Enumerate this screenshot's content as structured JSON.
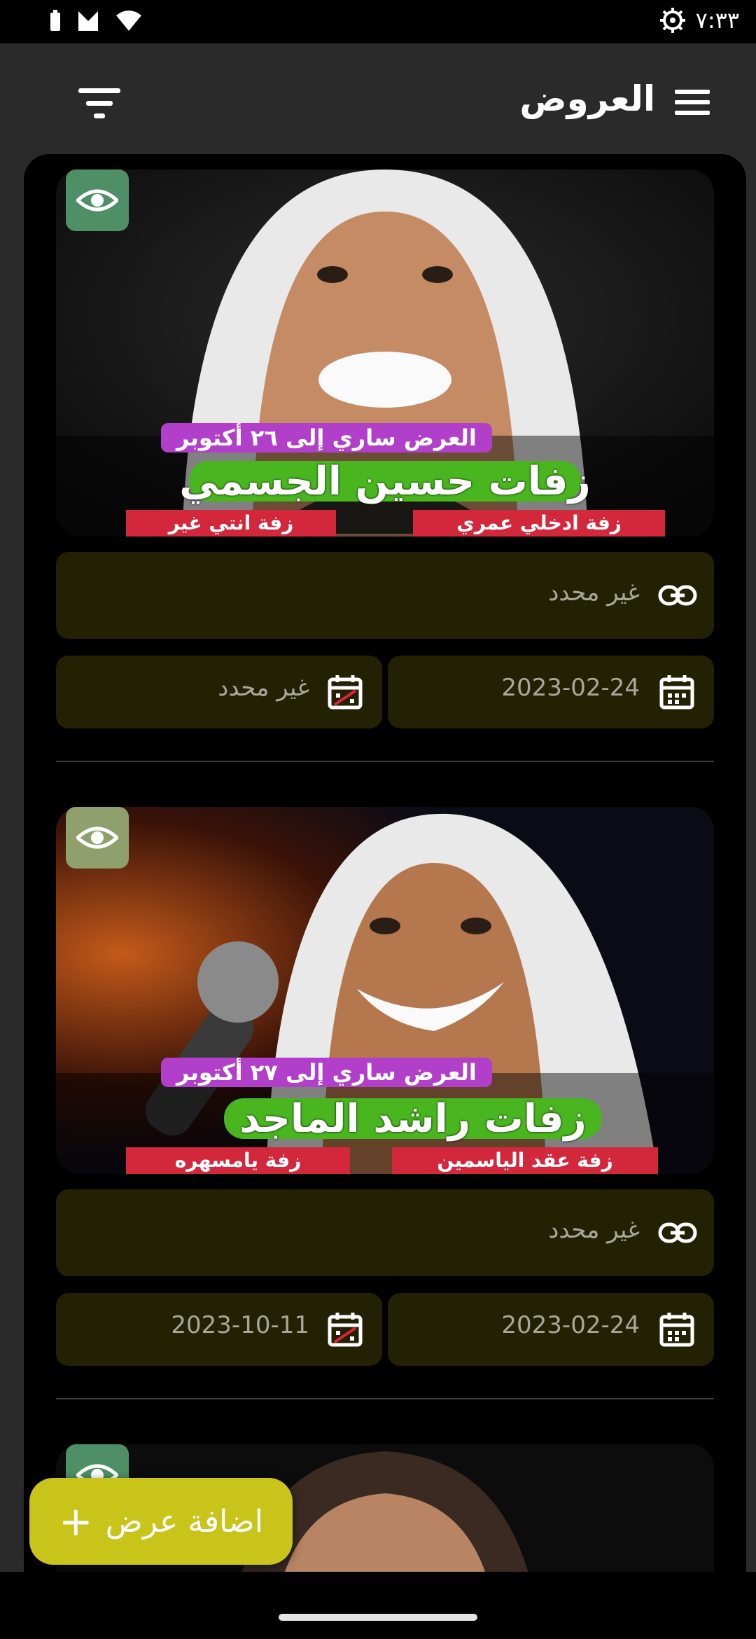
{
  "status_bar": {
    "time": "٧:٣٣",
    "icons": [
      "battery-icon",
      "signal-icon",
      "wifi-icon",
      "settings-gear-icon"
    ]
  },
  "header": {
    "title": "العروض",
    "menu_icon": "hamburger-menu-icon",
    "filter_icon": "filter-icon"
  },
  "offers": [
    {
      "visibility_icon": "eye-icon",
      "image": {
        "promo_text": "العرض ساري إلى ٢٦ أكتوبر",
        "artist_name": "زفات حسين الجسمي",
        "song_right": "زفة ادخلي عمري",
        "song_left": "زفة انتي غير"
      },
      "link": "غير محدد",
      "start_date": "2023-02-24",
      "end_date": "غير محدد"
    },
    {
      "visibility_icon": "eye-icon",
      "image": {
        "promo_text": "العرض ساري إلى ٢٧ أكتوبر",
        "artist_name": "زفات راشد الماجد",
        "song_right": "زفة عقد الياسمين",
        "song_left": "زفة يامسهره"
      },
      "link": "غير محدد",
      "start_date": "2023-02-24",
      "end_date": "2023-10-11"
    },
    {
      "visibility_icon": "eye-icon"
    }
  ],
  "fab": {
    "label": "اضافة عرض",
    "icon": "+"
  },
  "colors": {
    "background": "#2a2a2a",
    "card": "#000000",
    "field": "#232103",
    "fab": "#c9c41a",
    "eye_badge": "#4e8f66",
    "banner_green": "#49b61f",
    "promo_purple": "#b23fc9",
    "song_red": "#d3273c"
  }
}
